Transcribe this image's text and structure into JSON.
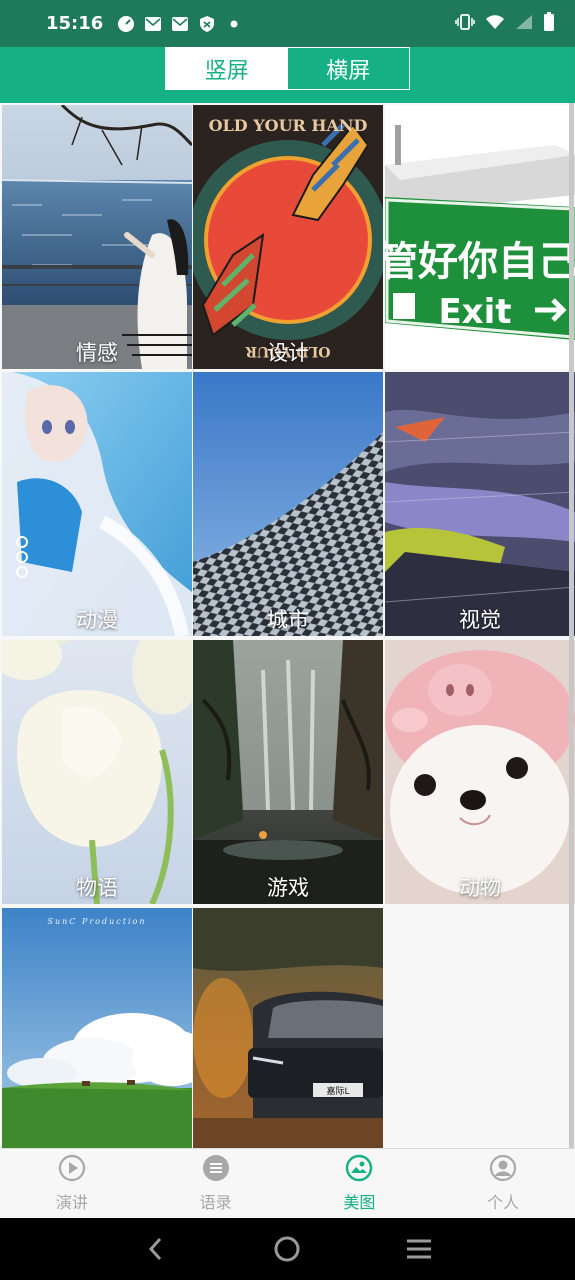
{
  "status": {
    "time": "15:16"
  },
  "header": {
    "tabs": [
      "竖屏",
      "横屏"
    ],
    "active": 0
  },
  "grid": {
    "tiles": [
      {
        "label": "情感"
      },
      {
        "label": "设计",
        "art_text_top": "OLD YOUR HAND",
        "art_text_bottom": "OLD YOUR"
      },
      {
        "label": "",
        "art_text": "管好你自己",
        "art_sub": "Exit"
      },
      {
        "label": "动漫"
      },
      {
        "label": "城市"
      },
      {
        "label": "视觉"
      },
      {
        "label": "物语"
      },
      {
        "label": "游戏"
      },
      {
        "label": "动物"
      },
      {
        "label": "",
        "art_text": "SunC Production"
      },
      {
        "label": "",
        "art_text": "嘉际L"
      }
    ]
  },
  "tabbar": {
    "items": [
      {
        "label": "演讲",
        "icon": "play-circle-icon"
      },
      {
        "label": "语录",
        "icon": "list-circle-icon"
      },
      {
        "label": "美图",
        "icon": "image-circle-icon"
      },
      {
        "label": "个人",
        "icon": "person-circle-icon"
      }
    ],
    "active": 2
  },
  "colors": {
    "accent": "#15b083",
    "statusbar": "#1e7a5a",
    "inactive": "#a8a8a8"
  }
}
